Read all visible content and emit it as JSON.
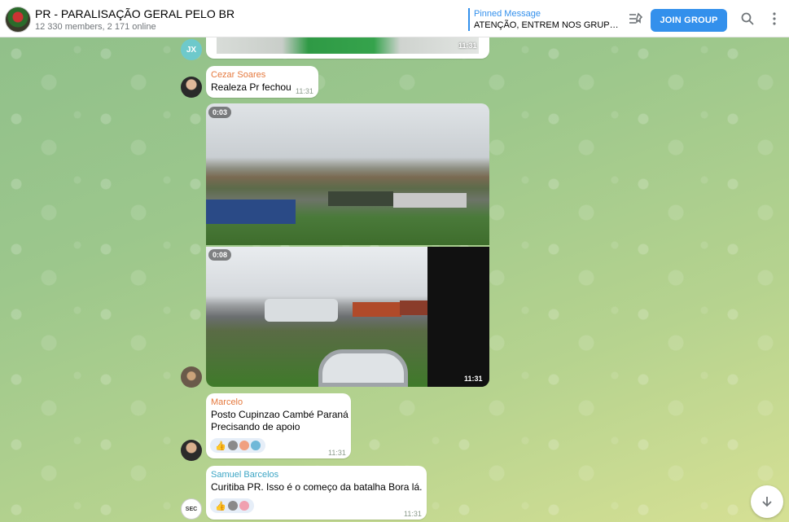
{
  "header": {
    "title": "PR - PARALISAÇÃO GERAL PELO BR",
    "subtitle": "12 330 members, 2 171 online",
    "pinned_label": "Pinned Message",
    "pinned_text": "ATENÇÃO, ENTREM NOS GRUPOS D...",
    "join_label": "JOIN GROUP"
  },
  "icons": {
    "pin_list": "pin-list-icon",
    "search": "search-icon",
    "more": "more-vertical-icon",
    "scroll_down": "arrow-down-icon"
  },
  "messages": {
    "top_media_time": "11:31",
    "top_avatar_initials": "JX",
    "cezar": {
      "sender": "Cezar Soares",
      "text": "Realeza Pr fechou",
      "time": "11:31"
    },
    "videos": {
      "first_duration": "0:03",
      "second_duration": "0:08",
      "time": "11:31"
    },
    "marcelo": {
      "sender": "Marcelo",
      "line1": "Posto Cupinzao Cambé Paraná",
      "line2": "Precisando de apoio",
      "time": "11:31"
    },
    "samuel": {
      "sender": "Samuel Barcelos",
      "text": "Curitiba PR. Isso é o começo da batalha  Bora lá.",
      "time": "11:31",
      "avatar_text": "SEC"
    }
  },
  "colors": {
    "accent": "#3390ec",
    "cezar_name": "#e5793e",
    "marcelo_name": "#e5793e",
    "samuel_name": "#3ca5c4",
    "jx_avatar": "#6ec9cb"
  }
}
